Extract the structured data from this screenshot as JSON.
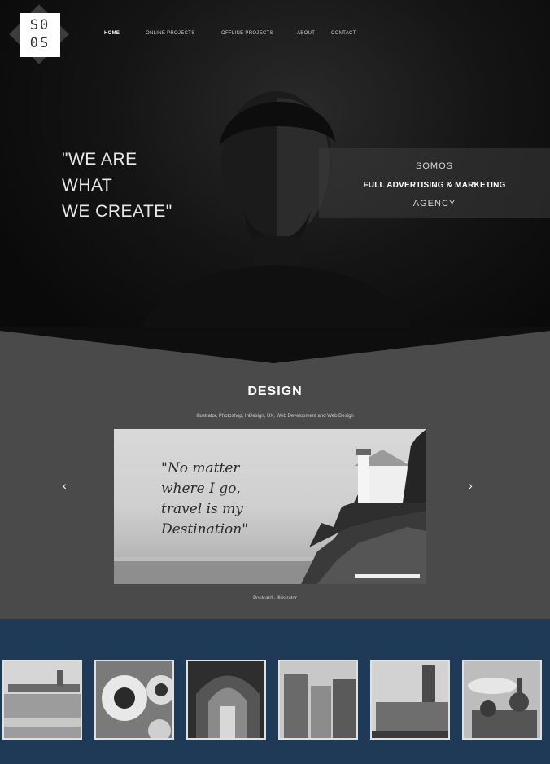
{
  "logo": {
    "text_line1": "S0",
    "text_line2": "0S"
  },
  "nav": {
    "items": [
      {
        "label": "HOME",
        "active": true
      },
      {
        "label": "ONLINE PROJECTS",
        "active": false
      },
      {
        "label": "OFFLINE PROJECTS",
        "active": false
      },
      {
        "label": "ABOUT",
        "active": false
      },
      {
        "label": "CONTACT",
        "active": false
      }
    ]
  },
  "hero": {
    "quote_lines": [
      "\"WE ARE",
      "WHAT",
      "WE CREATE\""
    ],
    "agency": {
      "line1": "SOMOS",
      "line2": "FULL ADVERTISING & MARKETING",
      "line3": "AGENCY"
    }
  },
  "design": {
    "title": "DESIGN",
    "subtitle": "Illustrator, Photoshop, InDesign, UX, Web Development and Web Design",
    "prev_glyph": "‹",
    "next_glyph": "›",
    "slide_text_lines": [
      "\"No matter",
      "where I go,",
      "travel is my",
      "Destination\""
    ],
    "caption": "Postcard - Illustrator"
  },
  "gallery": {
    "thumbnails": [
      "pier",
      "sunflowers",
      "cathedral",
      "old-town",
      "tower",
      "domes"
    ]
  },
  "colors": {
    "hero_bg": "#0a0a0a",
    "design_bg": "#4a4a4a",
    "gallery_bg": "#1e3a57"
  }
}
